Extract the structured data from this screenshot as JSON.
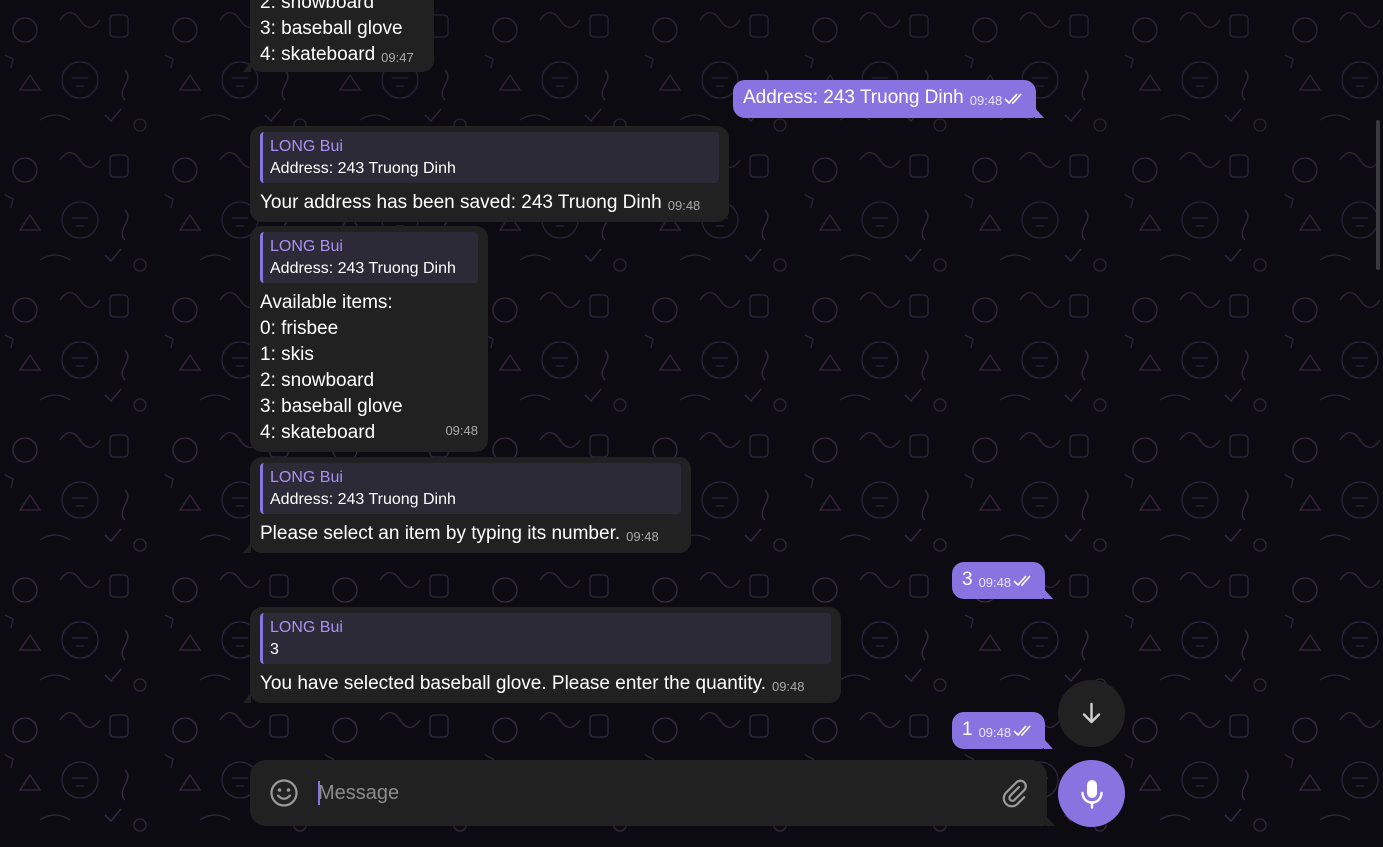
{
  "messages": {
    "m0": {
      "lines": [
        "2: snowboard",
        "3: baseball glove",
        "4: skateboard"
      ],
      "time": "09:47"
    },
    "m1": {
      "text": "Address: 243 Truong Dinh",
      "time": "09:48"
    },
    "m2": {
      "reply_name": "LONG Bui",
      "reply_text": "Address: 243 Truong Dinh",
      "text": "Your address has been saved: 243 Truong Dinh",
      "time": "09:48"
    },
    "m3": {
      "reply_name": "LONG Bui",
      "reply_text": "Address: 243 Truong Dinh",
      "lines": [
        "Available items:",
        "0: frisbee",
        "1: skis",
        "2: snowboard",
        "3: baseball glove",
        "4: skateboard"
      ],
      "time": "09:48"
    },
    "m4": {
      "reply_name": "LONG Bui",
      "reply_text": "Address: 243 Truong Dinh",
      "text": "Please select an item by typing its number.",
      "time": "09:48"
    },
    "m5": {
      "text": "3",
      "time": "09:48"
    },
    "m6": {
      "reply_name": "LONG Bui",
      "reply_text": "3",
      "text": "You have selected baseball glove. Please enter the quantity.",
      "time": "09:48"
    },
    "m7": {
      "text": "1",
      "time": "09:48"
    }
  },
  "composer": {
    "placeholder": "Message",
    "value": ""
  },
  "icons": {
    "emoji": "smile-icon",
    "attach": "paperclip-icon",
    "mic": "microphone-icon",
    "scroll_down": "arrow-down-icon",
    "read_status": "double-check-icon"
  },
  "colors": {
    "background": "#0d0b12",
    "incoming_bubble": "#212121",
    "outgoing_bubble": "#8774e1",
    "reply_name": "#a891f0",
    "accent": "#8774e1"
  }
}
